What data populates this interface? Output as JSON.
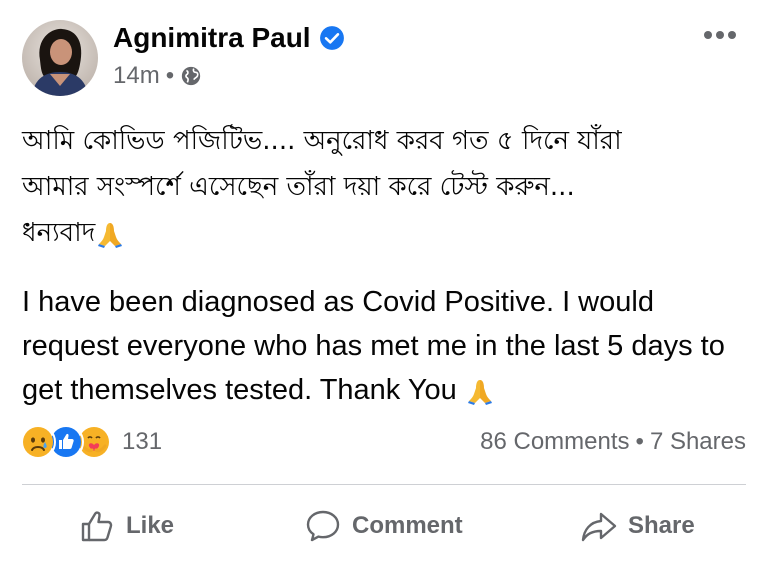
{
  "post": {
    "author": "Agnimitra Paul",
    "time": "14m",
    "separator": "•",
    "text_bengali": "আমি কোভিড পজিটিভ.... অনুরোধ করব গত ৫ দিনে যাঁরা\nআমার সংস্পর্শে এসেছেন তাঁরা দয়া করে টেস্ট করুন...\nধন্যবাদ",
    "text_english": "I have been diagnosed as Covid Positive. I would\nrequest everyone who has met me in the last 5 days to\nget themselves tested. Thank You "
  },
  "reactions": {
    "types": [
      "sad",
      "like",
      "care"
    ],
    "count": "131"
  },
  "stats": {
    "comments": "86 Comments",
    "dot": "•",
    "shares": "7 Shares"
  },
  "actions": {
    "like": "Like",
    "comment": "Comment",
    "share": "Share"
  },
  "colors": {
    "verified": "#1877f2",
    "secondary_text": "#65676b",
    "like_blue": "#1877f2",
    "sad_yellow": "#f7b125",
    "divider": "#ced0d4"
  },
  "icons": [
    "verified-badge-icon",
    "globe-icon",
    "more-options-icon",
    "folded-hands-emoji",
    "sad-reaction-icon",
    "like-reaction-icon",
    "care-reaction-icon",
    "thumbs-up-icon",
    "comment-bubble-icon",
    "share-arrow-icon"
  ]
}
